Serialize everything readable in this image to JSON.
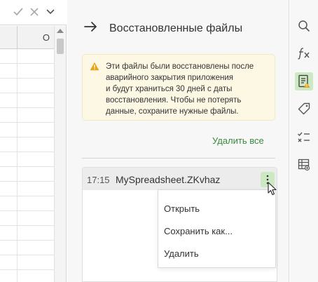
{
  "sheet": {
    "column_label": "O"
  },
  "panel": {
    "title": "Восстановленные файлы",
    "notice_lines": [
      "Эти файлы были восстановлены после",
      "аварийного закрытия приложения",
      "и будут храниться 30 дней с даты",
      "восстановления. Чтобы не потерять",
      "данные, сохраните нужные файлы."
    ],
    "delete_all_label": "Удалить все",
    "file": {
      "time": "17:15",
      "name": "MySpreadsheet.ZKvhaz"
    },
    "menu": {
      "open_label": "Открыть",
      "save_as_label": "Сохранить как...",
      "delete_label": "Удалить"
    }
  },
  "toolbar": {
    "icons": [
      "search-icon",
      "function-icon",
      "recovered-files-icon",
      "tag-icon",
      "checklist-icon",
      "data-table-icon"
    ]
  },
  "colors": {
    "accent_green": "#3b8a3d",
    "active_bg": "#cde9c4",
    "notice_bg": "#fdf8e4",
    "warning_orange": "#e8a317"
  }
}
